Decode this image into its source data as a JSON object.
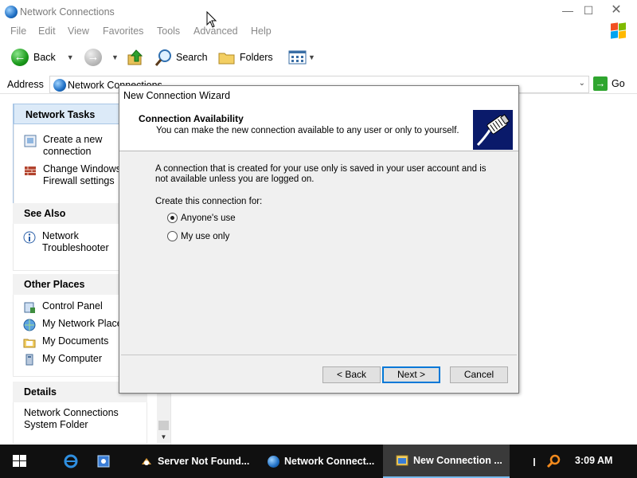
{
  "window": {
    "title": "Network Connections",
    "controls": {
      "minimize": "—",
      "maximize": "☐",
      "close": "✕"
    }
  },
  "menu": [
    "File",
    "Edit",
    "View",
    "Favorites",
    "Tools",
    "Advanced",
    "Help"
  ],
  "toolbar": {
    "back": "Back",
    "search": "Search",
    "folders": "Folders"
  },
  "address": {
    "label": "Address",
    "value": "Network Connections",
    "go": "Go"
  },
  "taskpane": {
    "network_tasks": {
      "header": "Network Tasks",
      "items": [
        {
          "line1": "Create a new",
          "line2": "connection"
        },
        {
          "line1": "Change Windows",
          "line2": "Firewall settings"
        }
      ]
    },
    "see_also": {
      "header": "See Also",
      "items": [
        {
          "line1": "Network",
          "line2": "Troubleshooter"
        }
      ]
    },
    "other_places": {
      "header": "Other Places",
      "items": [
        "Control Panel",
        "My Network Places",
        "My Documents",
        "My Computer"
      ]
    },
    "details": {
      "header": "Details",
      "line1": "Network Connections",
      "line2": "System Folder"
    }
  },
  "wizard": {
    "title": "New Connection Wizard",
    "heading": "Connection Availability",
    "subheading": "You can make the new connection available to any user or only to yourself.",
    "description": "A connection that is created for your use only is saved in your user account and is not available unless you are logged on.",
    "create_for_label": "Create this connection for:",
    "options": [
      {
        "label": "Anyone's use",
        "selected": true
      },
      {
        "label": "My use only",
        "selected": false
      }
    ],
    "buttons": {
      "back": "< Back",
      "next": "Next >",
      "cancel": "Cancel"
    }
  },
  "taskbar": {
    "items": [
      {
        "label": "Server Not Found...",
        "active": false
      },
      {
        "label": "Network Connect...",
        "active": false
      },
      {
        "label": "New Connection ...",
        "active": true
      }
    ],
    "clock": "3:09 AM"
  },
  "colors": {
    "taskbar": "#101010",
    "panel_header_blue": "#dceaf8",
    "accent": "#0078d7"
  }
}
